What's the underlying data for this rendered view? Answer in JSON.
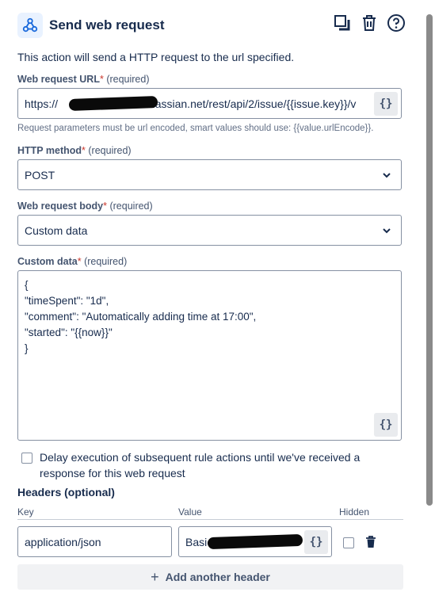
{
  "header": {
    "title": "Send web request"
  },
  "description": "This action will send a HTTP request to the url specified.",
  "url_field": {
    "label": "Web request URL",
    "required_mark": "*",
    "required_text": "(required)",
    "value_prefix": "https://",
    "value_visible": ".atlassian.net/rest/api/2/issue/{{issue.key}}/v",
    "smart_btn": "{}"
  },
  "url_hint": "Request parameters must be url encoded, smart values should use: {{value.urlEncode}}.",
  "method_field": {
    "label": "HTTP method",
    "required_mark": "*",
    "required_text": "(required)",
    "value": "POST"
  },
  "body_field": {
    "label": "Web request body",
    "required_mark": "*",
    "required_text": "(required)",
    "value": "Custom data"
  },
  "custom_data": {
    "label": "Custom data",
    "required_mark": "*",
    "required_text": "(required)",
    "value": "{\n\"timeSpent\": \"1d\",\n\"comment\": \"Automatically adding time at 17:00\",\n\"started\": \"{{now}}\"\n}",
    "smart_btn": "{}"
  },
  "delay_checkbox": {
    "checked": false,
    "label": "Delay execution of subsequent rule actions until we've received a response for this web request"
  },
  "headers": {
    "title": "Headers (optional)",
    "col_key": "Key",
    "col_value": "Value",
    "col_hidden": "Hidden",
    "rows": [
      {
        "key": "application/json",
        "value_prefix": "Basic",
        "hidden": false,
        "smart_btn": "{}"
      }
    ],
    "add_label": "Add another header"
  },
  "colors": {
    "accent": "#0c66e4",
    "text": "#172b4d",
    "subtle": "#44546f",
    "border": "#8590a2"
  }
}
